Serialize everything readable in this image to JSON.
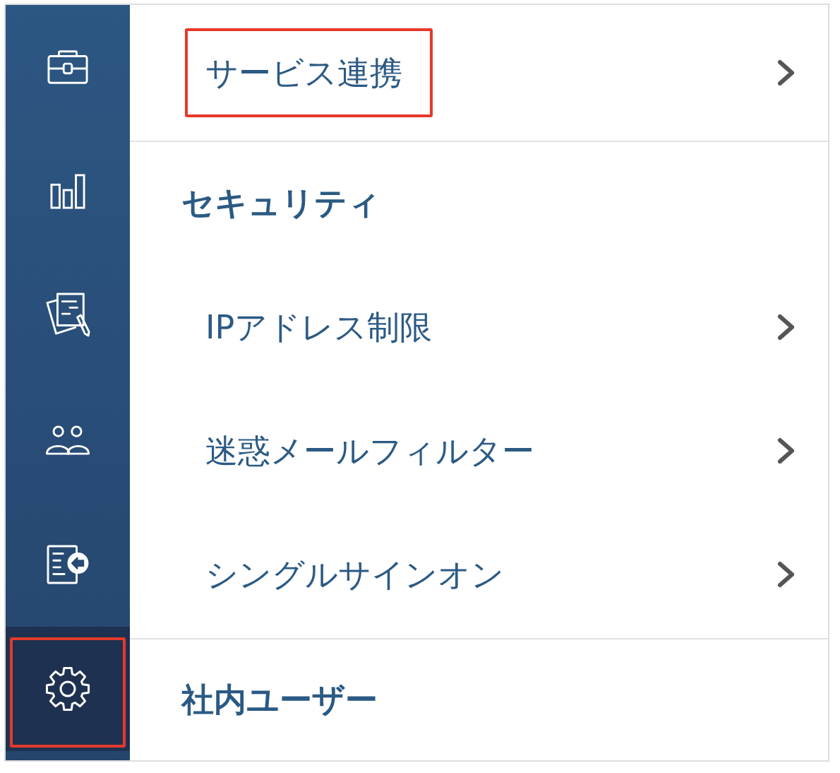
{
  "sidebar": {
    "items": [
      {
        "kind": "briefcase",
        "selected": false,
        "highlighted": false
      },
      {
        "kind": "chart",
        "selected": false,
        "highlighted": false
      },
      {
        "kind": "documents",
        "selected": false,
        "highlighted": false
      },
      {
        "kind": "people",
        "selected": false,
        "highlighted": false
      },
      {
        "kind": "export",
        "selected": false,
        "highlighted": false
      },
      {
        "kind": "gear",
        "selected": true,
        "highlighted": true
      }
    ]
  },
  "menu": [
    {
      "kind": "link",
      "label": "サービス連携",
      "highlighted": true
    },
    {
      "kind": "section",
      "label": "セキュリティ",
      "children": [
        {
          "label": "IPアドレス制限",
          "highlighted": false
        },
        {
          "label": "迷惑メールフィルター",
          "highlighted": false
        },
        {
          "label": "シングルサインオン",
          "highlighted": false
        }
      ]
    },
    {
      "kind": "section",
      "label": "社内ユーザー"
    }
  ]
}
